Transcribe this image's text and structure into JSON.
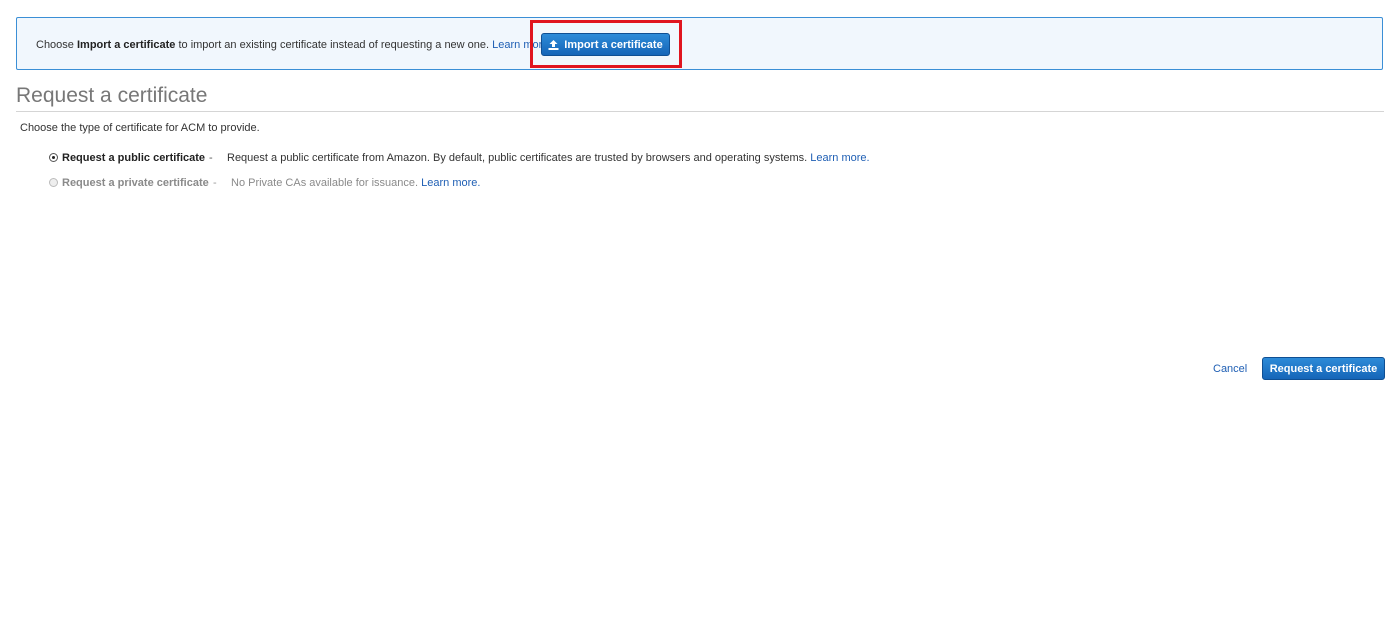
{
  "banner": {
    "text_before": "Choose ",
    "text_bold": "Import a certificate",
    "text_after": " to import an existing certificate instead of requesting a new one. ",
    "learn_more": "Learn more.",
    "import_button_label": "Import a certificate"
  },
  "page": {
    "title": "Request a certificate",
    "intro": "Choose the type of certificate for ACM to provide."
  },
  "options": [
    {
      "label": "Request a public certificate",
      "separator": "-",
      "description": "Request a public certificate from Amazon. By default, public certificates are trusted by browsers and operating systems.",
      "learn_more": "Learn more.",
      "selected": true,
      "disabled": false
    },
    {
      "label": "Request a private certificate",
      "separator": "-",
      "description": "No Private CAs available for issuance.",
      "learn_more": "Learn more.",
      "selected": false,
      "disabled": true
    }
  ],
  "footer": {
    "cancel_label": "Cancel",
    "submit_label": "Request a certificate"
  },
  "colors": {
    "primary": "#1f73c9",
    "link": "#1f5fb4",
    "highlight": "#e0151f",
    "banner_border": "#3b8fd6",
    "banner_bg": "#f1f7fd"
  },
  "icons": {
    "import_button": "upload-icon"
  }
}
